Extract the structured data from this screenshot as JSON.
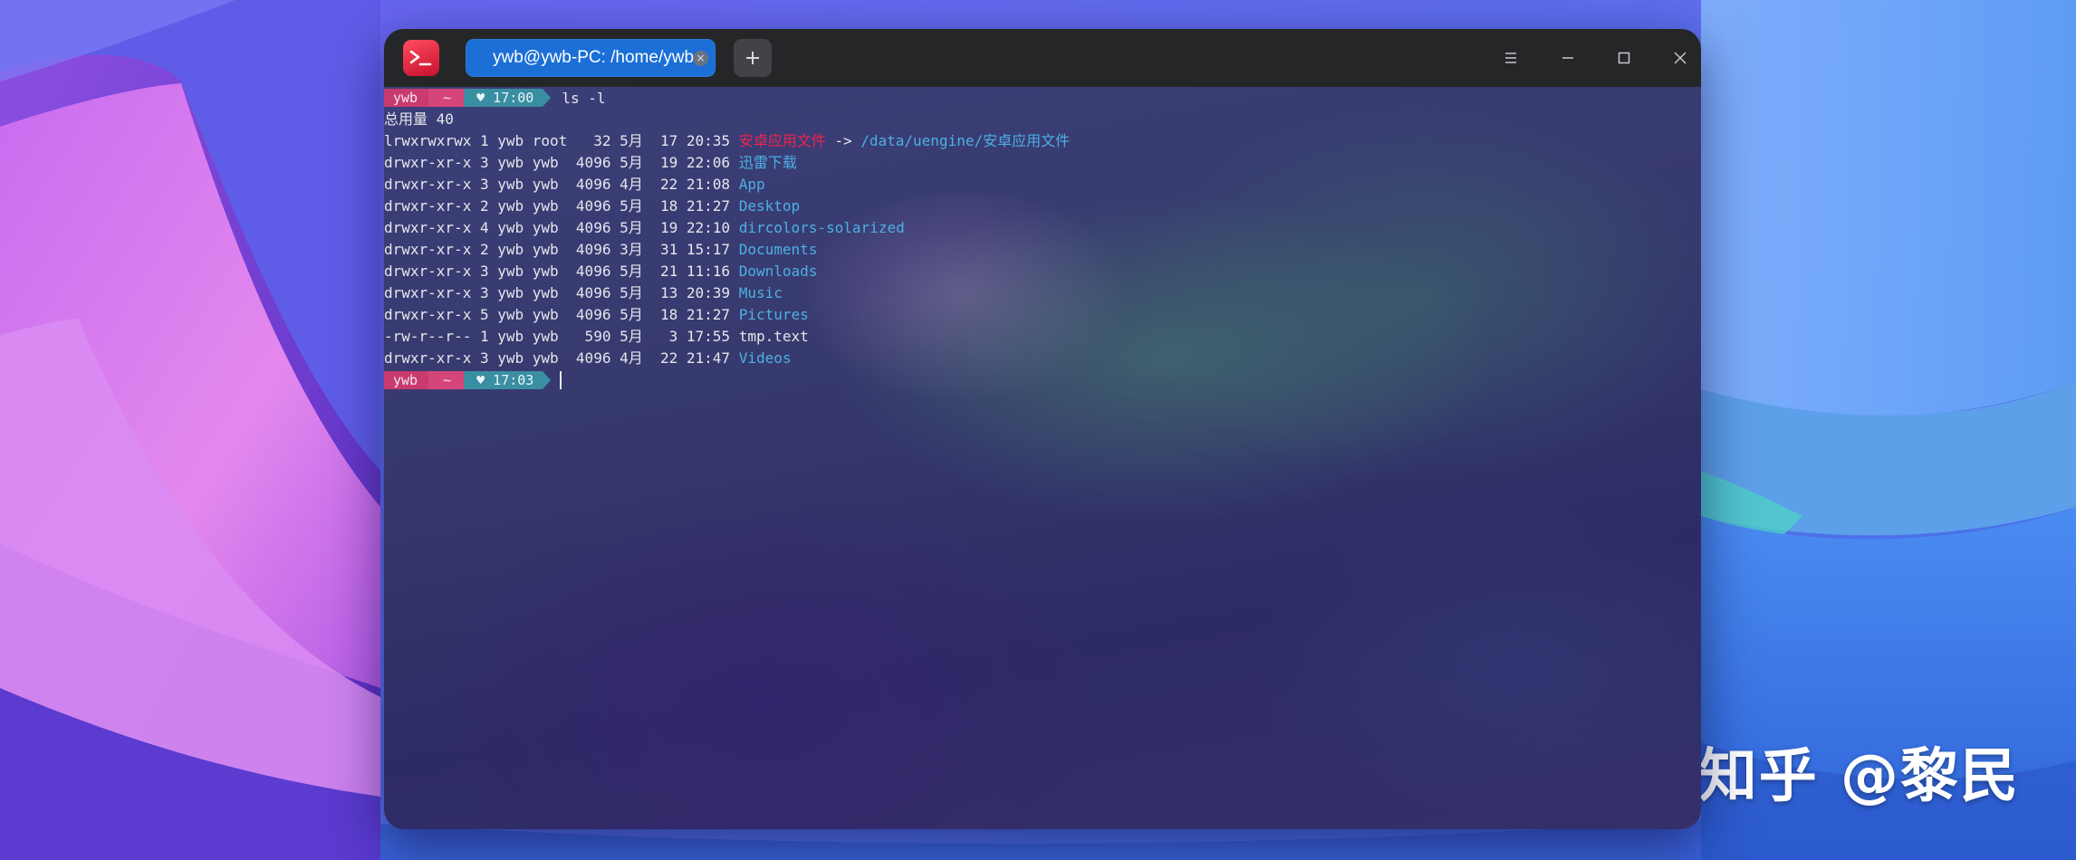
{
  "window": {
    "tab_title": "ywb@ywb-PC: /home/ywb",
    "new_tab_label": "+"
  },
  "terminal": {
    "prompt1": {
      "user": "ywb",
      "dir": "~",
      "time_icon": "heart-icon",
      "time": "♥ 17:00",
      "command": "ls -l"
    },
    "total": "总用量 40",
    "rows": [
      {
        "meta": "lrwxrwxrwx 1 ywb root   32 5月  17 20:35 ",
        "name": "安卓应用文件",
        "arrow": " -> ",
        "target": "/data/uengine/安卓应用文件"
      },
      {
        "meta": "drwxr-xr-x 3 ywb ywb  4096 5月  19 22:06 ",
        "name": "迅雷下载"
      },
      {
        "meta": "drwxr-xr-x 3 ywb ywb  4096 4月  22 21:08 ",
        "name": "App"
      },
      {
        "meta": "drwxr-xr-x 2 ywb ywb  4096 5月  18 21:27 ",
        "name": "Desktop"
      },
      {
        "meta": "drwxr-xr-x 4 ywb ywb  4096 5月  19 22:10 ",
        "name": "dircolors-solarized"
      },
      {
        "meta": "drwxr-xr-x 2 ywb ywb  4096 3月  31 15:17 ",
        "name": "Documents"
      },
      {
        "meta": "drwxr-xr-x 3 ywb ywb  4096 5月  21 11:16 ",
        "name": "Downloads"
      },
      {
        "meta": "drwxr-xr-x 3 ywb ywb  4096 5月  13 20:39 ",
        "name": "Music"
      },
      {
        "meta": "drwxr-xr-x 5 ywb ywb  4096 5月  18 21:27 ",
        "name": "Pictures"
      },
      {
        "meta": "-rw-r--r-- 1 ywb ywb   590 5月   3 17:55 ",
        "name": "tmp.text"
      },
      {
        "meta": "drwxr-xr-x 3 ywb ywb  4096 4月  22 21:47 ",
        "name": "Videos"
      }
    ],
    "prompt2": {
      "user": "ywb",
      "dir": "~",
      "time": "♥ 17:03"
    }
  },
  "watermark": "知乎 @黎民",
  "colors": {
    "titlebar": "#252628",
    "tab_active": "#1b6fd6",
    "symlink_name": "#f0234f",
    "directory": "#4cb0e4",
    "prompt_user": "#c93a6e",
    "prompt_dir": "#d6457a",
    "prompt_time": "#3a8ea2"
  }
}
